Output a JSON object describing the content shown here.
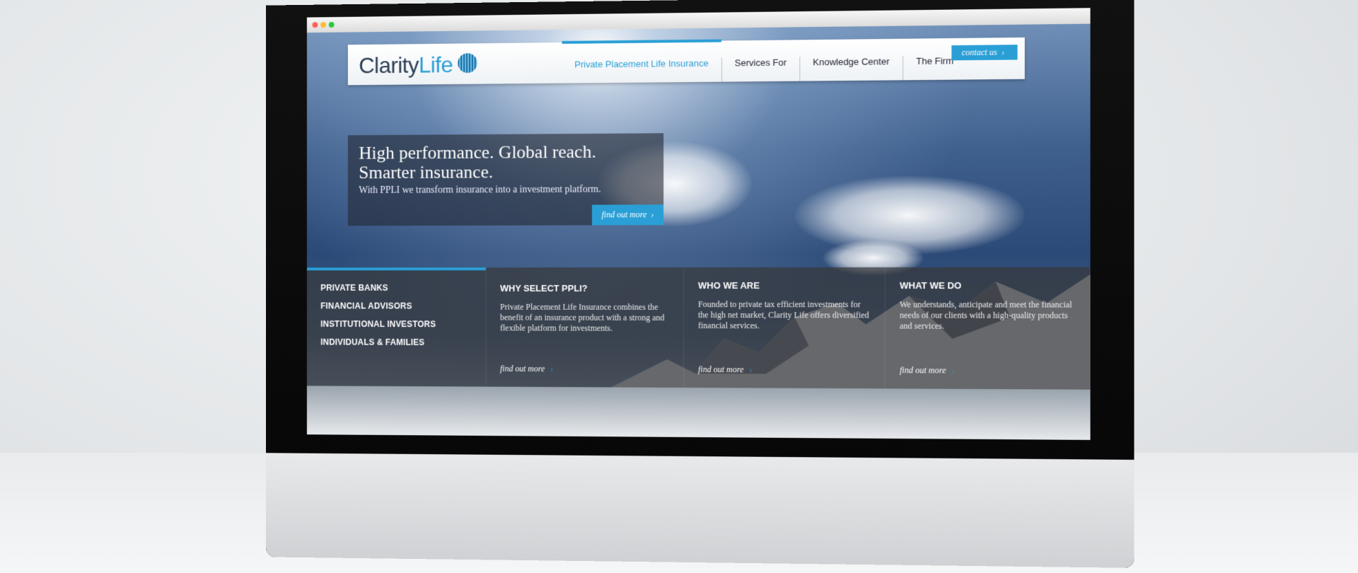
{
  "site": {
    "logo_text_clarity": "Clarity",
    "logo_text_life": "Life"
  },
  "nav": {
    "items": [
      {
        "label": "Private Placement Life Insurance",
        "active": true
      },
      {
        "label": "Services For",
        "active": false
      },
      {
        "label": "Knowledge Center",
        "active": false
      },
      {
        "label": "The Firm",
        "active": false
      }
    ],
    "contact_label": "contact us"
  },
  "hero": {
    "title": "High performance. Global reach. Smarter insurance.",
    "subtitle": "With PPLI we transform insurance into a investment platform.",
    "cta": "find out more"
  },
  "audience_menu": [
    "PRIVATE BANKS",
    "FINANCIAL ADVISORS",
    "INSTITUTIONAL INVESTORS",
    "INDIVIDUALS & FAMILIES"
  ],
  "panels": [
    {
      "title": "WHY SELECT PPLI?",
      "text": "Private Placement Life Insurance combines the benefit of an insurance product with a strong and flexible platform for investments.",
      "cta": "find out more"
    },
    {
      "title": "WHO WE ARE",
      "text": "Founded to private tax efficient investments for the high net market, Clarity Life offers diversified financial services.",
      "cta": "find out more"
    },
    {
      "title": "WHAT WE DO",
      "text": "We understands, anticipate and meet the financial needs of our clients with a high-quality products and services.",
      "cta": "find out more"
    }
  ],
  "colors": {
    "accent": "#2a9fd6",
    "logo_dark": "#2c3e55"
  },
  "icons": {
    "apple": "apple-logo-icon",
    "chevron": "chevron-right-icon"
  }
}
